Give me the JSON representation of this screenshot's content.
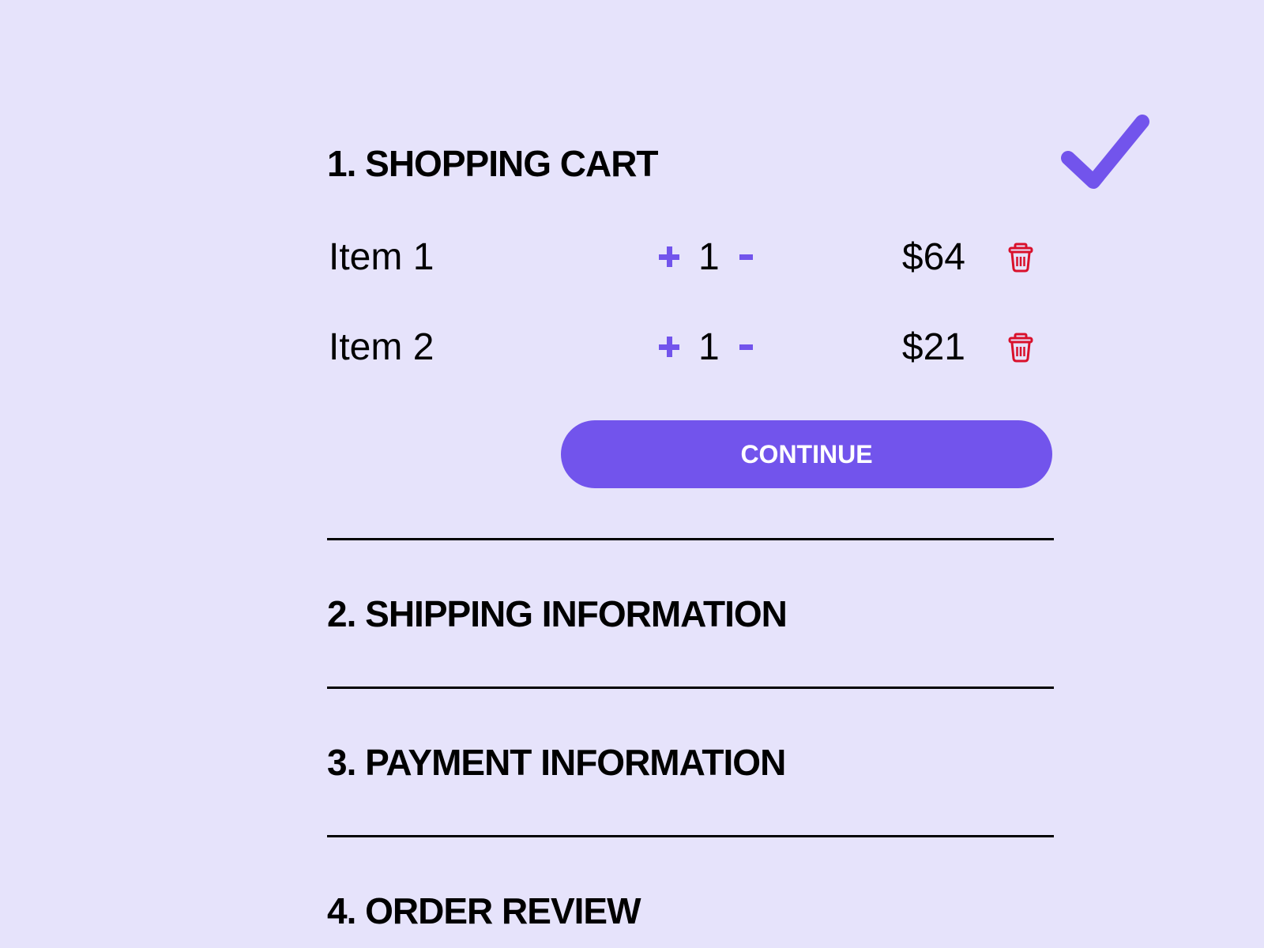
{
  "colors": {
    "background": "#e6e3fb",
    "accent": "#7254ec",
    "danger": "#d9112c",
    "text": "#000000"
  },
  "steps": [
    {
      "number": "1.",
      "title": "SHOPPING CART",
      "label": "1. SHOPPING CART",
      "completed": true
    },
    {
      "number": "2.",
      "title": "SHIPPING INFORMATION",
      "label": "2. SHIPPING INFORMATION"
    },
    {
      "number": "3.",
      "title": "PAYMENT INFORMATION",
      "label": "3. PAYMENT INFORMATION"
    },
    {
      "number": "4.",
      "title": "ORDER REVIEW",
      "label": "4. ORDER REVIEW"
    }
  ],
  "cart": {
    "items": [
      {
        "name": "Item 1",
        "quantity": "1",
        "price": "$64",
        "increment_icon": "plus-icon",
        "decrement_icon": "minus-icon",
        "delete_icon": "trash-icon"
      },
      {
        "name": "Item 2",
        "quantity": "1",
        "price": "$21",
        "increment_icon": "plus-icon",
        "decrement_icon": "minus-icon",
        "delete_icon": "trash-icon"
      }
    ],
    "continue_label": "CONTINUE"
  },
  "status_icon": "checkmark-icon"
}
